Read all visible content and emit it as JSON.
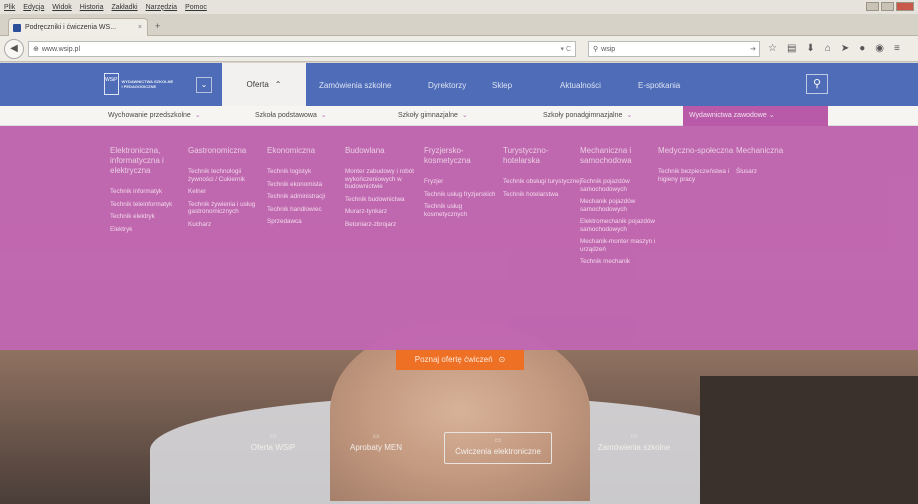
{
  "browser": {
    "menu": [
      "Plik",
      "Edycja",
      "Widok",
      "Historia",
      "Zakładki",
      "Narzędzia",
      "Pomoc"
    ],
    "tab_title": "Podręczniki i ćwiczenia WS...",
    "tab_close": "×",
    "new_tab": "+",
    "url": "www.wsip.pl",
    "search_value": "wsip"
  },
  "site": {
    "logo_text": "WYDAWNICTWA SZKOLNE I PEDAGOGICZNE",
    "logo_short": "WSiP",
    "nav": {
      "oferta": "Oferta",
      "items": [
        "Zamówienia szkolne",
        "Dyrektorzy",
        "Sklep",
        "Aktualności",
        "E-spotkania"
      ]
    },
    "categories": [
      "Wychowanie przedszkolne",
      "Szkoła podstawowa",
      "Szkoły gimnazjalne",
      "Szkoły ponadgimnazjalne",
      "Wydawnictwa zawodowe"
    ],
    "mega": [
      {
        "head": "Elektroniczna, informatyczna i elektryczna",
        "items": [
          "Technik informatyk",
          "Technik teleinformatyk",
          "Technik elektryk",
          "Elektryk"
        ]
      },
      {
        "head": "Gastronomiczna",
        "items": [
          "Technik technologii żywności / Cukiernik",
          "Kelner",
          "Technik żywienia i usług gastronomicznych",
          "Kucharz"
        ]
      },
      {
        "head": "Ekonomiczna",
        "items": [
          "Technik logistyk",
          "Technik ekonomista",
          "Technik administracji",
          "Technik handlowiec",
          "Sprzedawca"
        ]
      },
      {
        "head": "Budowlana",
        "items": [
          "Monter zabudowy i robót wykończeniowych w budownictwie",
          "Technik budownictwa",
          "Murarz-tynkarz",
          "Betoniarz-zbrojarz"
        ]
      },
      {
        "head": "Fryzjersko-kosmetyczna",
        "items": [
          "Fryzjer",
          "Technik usług fryzjerskich",
          "Technik usług kosmetycznych"
        ]
      },
      {
        "head": "Turystyczno-hotelarska",
        "items": [
          "Technik obsługi turystycznej",
          "Technik hotelarstwa"
        ]
      },
      {
        "head": "Mechaniczna i samochodowa",
        "items": [
          "Technik pojazdów samochodowych",
          "Mechanik pojazdów samochodowych",
          "Elektromechanik pojazdów samochodowych",
          "Mechanik-monter maszyn i urządzeń",
          "Technik mechanik"
        ]
      },
      {
        "head": "Medyczno-społeczna",
        "items": [
          "Technik bezpieczeństwa i higieny pracy"
        ]
      },
      {
        "head": "Mechaniczna",
        "items": [
          "Ślusarz"
        ]
      }
    ],
    "hero_button": "Poznaj ofertę ćwiczeń",
    "bottom_nav": [
      "Oferta WSiP",
      "Aprobaty MEN",
      "Ćwiczenia elektroniczne",
      "Zamówienia szkolne"
    ]
  }
}
